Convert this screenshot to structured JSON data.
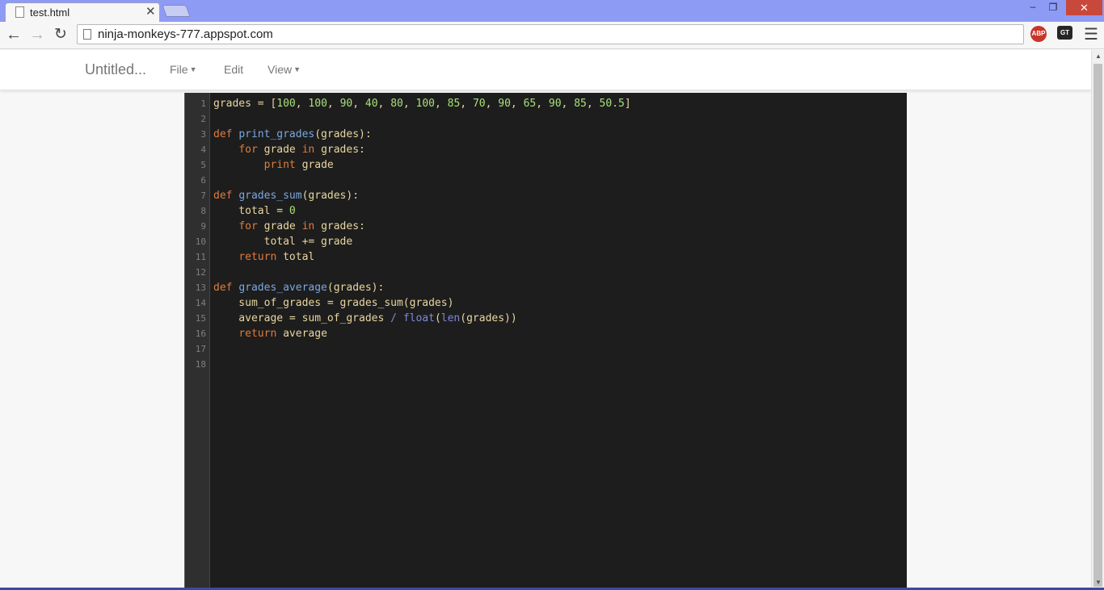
{
  "browser": {
    "tab_title": "test.html",
    "tab_close": "✕",
    "url": "ninja-monkeys-777.appspot.com",
    "extensions": [
      "ABP",
      "GT"
    ],
    "window_controls": {
      "minimize": "‒",
      "maximize": "❐",
      "close": "✕"
    }
  },
  "app": {
    "doc_title": "Untitled...",
    "menu": {
      "file": "File",
      "edit": "Edit",
      "view": "View"
    }
  },
  "editor": {
    "lines": [
      [
        [
          "",
          "grades = ["
        ],
        [
          "num",
          "100"
        ],
        [
          "",
          ", "
        ],
        [
          "num",
          "100"
        ],
        [
          "",
          ", "
        ],
        [
          "num",
          "90"
        ],
        [
          "",
          ", "
        ],
        [
          "num",
          "40"
        ],
        [
          "",
          ", "
        ],
        [
          "num",
          "80"
        ],
        [
          "",
          ", "
        ],
        [
          "num",
          "100"
        ],
        [
          "",
          ", "
        ],
        [
          "num",
          "85"
        ],
        [
          "",
          ", "
        ],
        [
          "num",
          "70"
        ],
        [
          "",
          ", "
        ],
        [
          "num",
          "90"
        ],
        [
          "",
          ", "
        ],
        [
          "num",
          "65"
        ],
        [
          "",
          ", "
        ],
        [
          "num",
          "90"
        ],
        [
          "",
          ", "
        ],
        [
          "num",
          "85"
        ],
        [
          "",
          ", "
        ],
        [
          "num",
          "50.5"
        ],
        [
          "",
          "]"
        ]
      ],
      [],
      [
        [
          "kw",
          "def "
        ],
        [
          "fn",
          "print_grades"
        ],
        [
          "",
          "(grades):"
        ]
      ],
      [
        [
          "",
          "    "
        ],
        [
          "kw",
          "for"
        ],
        [
          "",
          " grade "
        ],
        [
          "kw",
          "in"
        ],
        [
          "",
          " grades:"
        ]
      ],
      [
        [
          "",
          "        "
        ],
        [
          "kw",
          "print"
        ],
        [
          "",
          " grade"
        ]
      ],
      [],
      [
        [
          "kw",
          "def "
        ],
        [
          "fn",
          "grades_sum"
        ],
        [
          "",
          "(grades):"
        ]
      ],
      [
        [
          "",
          "    total = "
        ],
        [
          "num",
          "0"
        ]
      ],
      [
        [
          "",
          "    "
        ],
        [
          "kw",
          "for"
        ],
        [
          "",
          " grade "
        ],
        [
          "kw",
          "in"
        ],
        [
          "",
          " grades:"
        ]
      ],
      [
        [
          "",
          "        total += grade"
        ]
      ],
      [
        [
          "",
          "    "
        ],
        [
          "kw",
          "return"
        ],
        [
          "",
          " total"
        ]
      ],
      [],
      [
        [
          "kw",
          "def "
        ],
        [
          "fn",
          "grades_average"
        ],
        [
          "",
          "(grades):"
        ]
      ],
      [
        [
          "",
          "    sum_of_grades = grades_sum(grades)"
        ]
      ],
      [
        [
          "",
          "    average = sum_of_grades "
        ],
        [
          "builtin",
          "/"
        ],
        [
          "",
          " "
        ],
        [
          "builtin",
          "float"
        ],
        [
          "",
          "("
        ],
        [
          "builtin",
          "len"
        ],
        [
          "",
          "(grades))"
        ]
      ],
      [
        [
          "",
          "    "
        ],
        [
          "kw",
          "return"
        ],
        [
          "",
          " average"
        ]
      ],
      [],
      []
    ]
  }
}
